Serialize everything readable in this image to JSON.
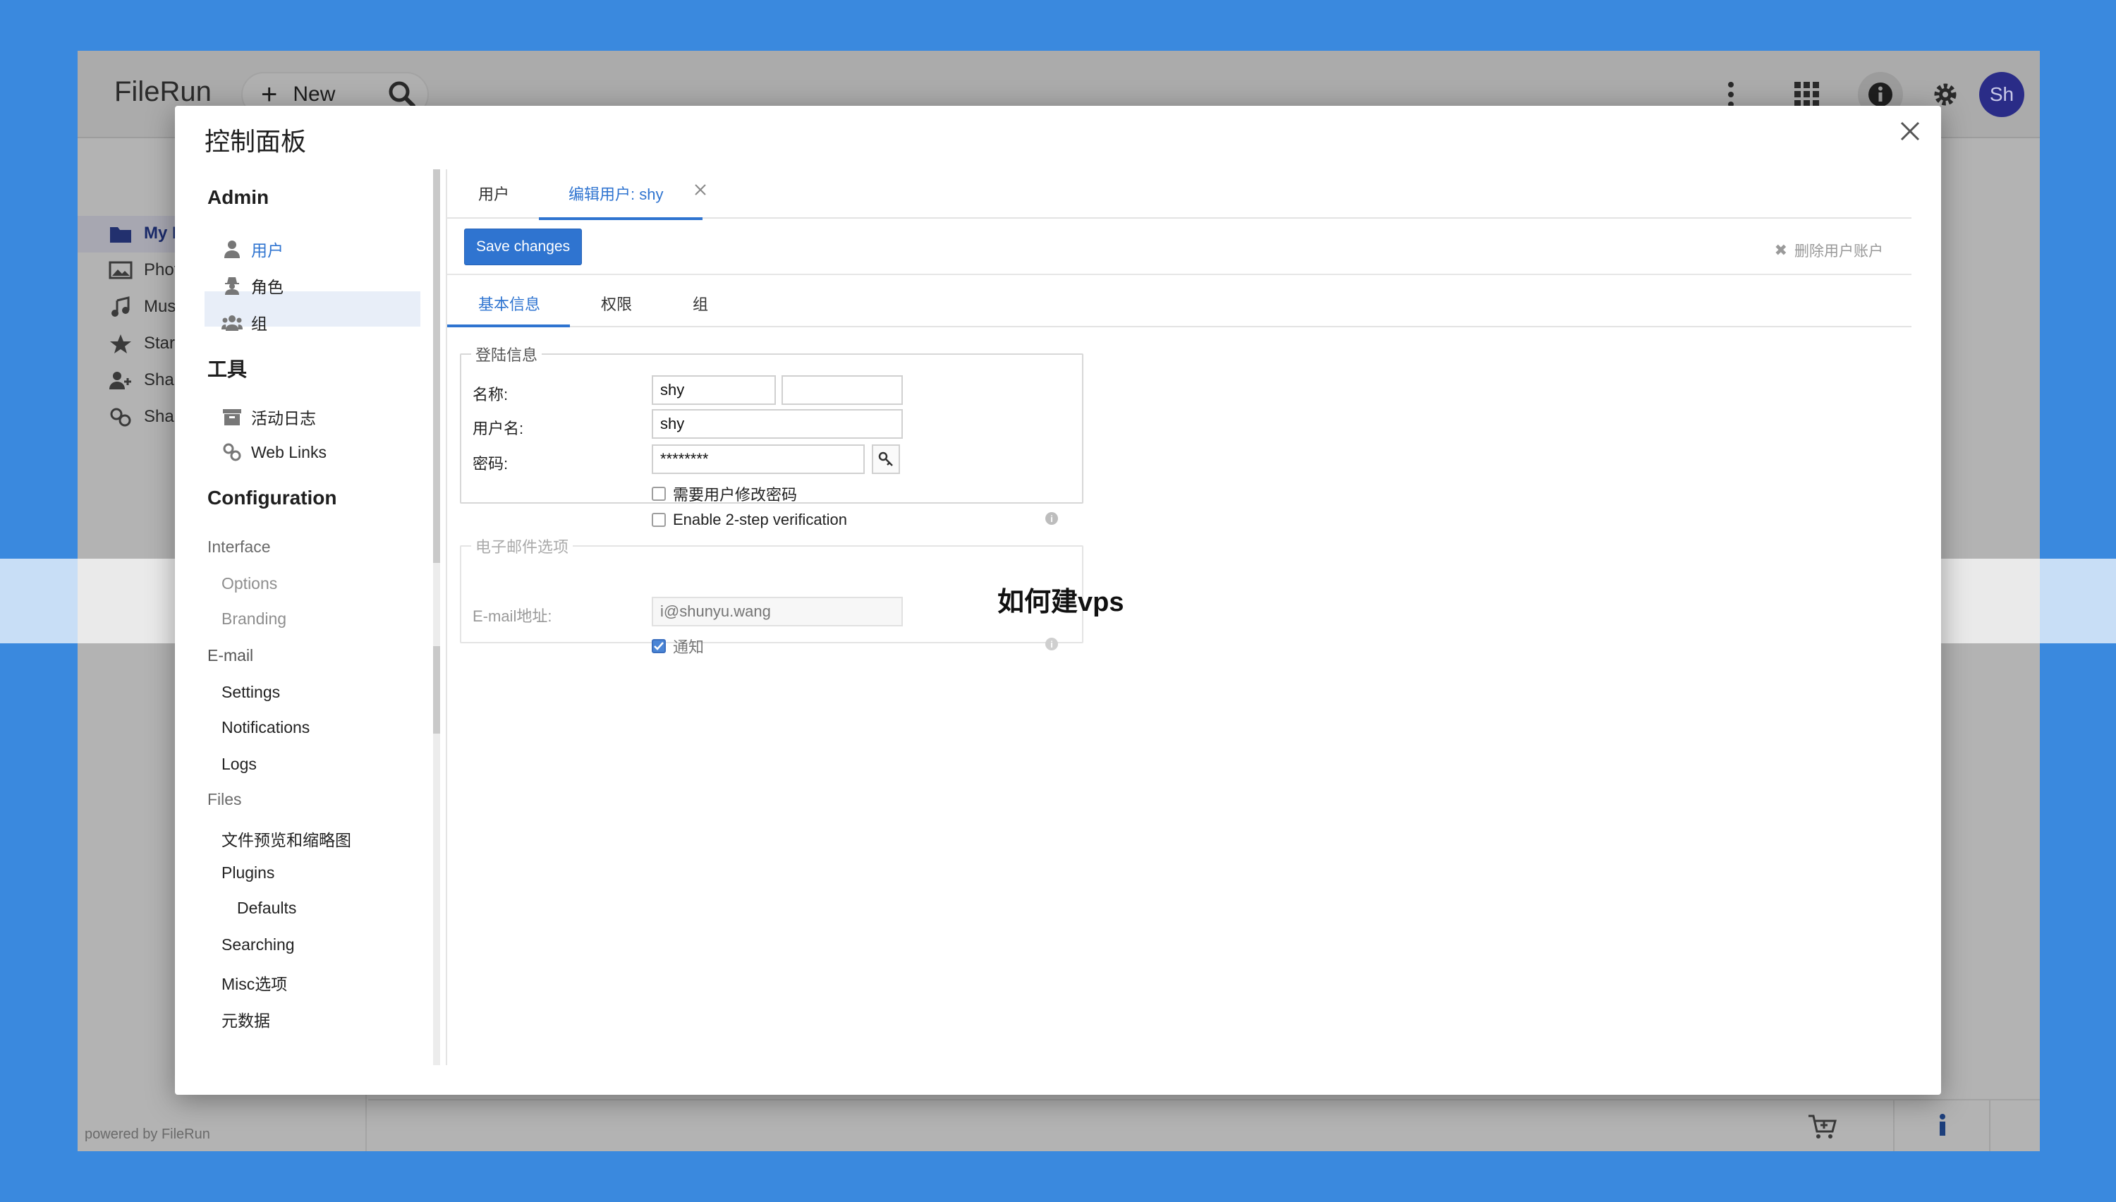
{
  "app": {
    "title": "FileRun",
    "new_button": "New",
    "avatar_initials": "Sh",
    "powered_by": "powered by FileRun",
    "sidenav": [
      "My F",
      "Phot",
      "Mus",
      "Star",
      "Shar",
      "Shar"
    ]
  },
  "modal": {
    "title": "控制面板",
    "nav": {
      "admin_heading": "Admin",
      "admin_items": [
        "用户",
        "角色",
        "组"
      ],
      "tools_heading": "工具",
      "tools_items": [
        "活动日志",
        "Web Links"
      ],
      "config_heading": "Configuration",
      "interface_label": "Interface",
      "interface_items": [
        "Options",
        "Branding"
      ],
      "email_label": "E-mail",
      "email_items": [
        "Settings",
        "Notifications",
        "Logs"
      ],
      "files_label": "Files",
      "files_items": [
        "文件预览和缩略图",
        "Plugins",
        "Defaults",
        "Searching",
        "Misc选项",
        "元数据"
      ]
    },
    "tabs": [
      "用户",
      "编辑用户: shy"
    ],
    "save_button": "Save changes",
    "delete_link": "删除用户账户",
    "inner_tabs": [
      "基本信息",
      "权限",
      "组"
    ],
    "login_section": {
      "legend": "登陆信息",
      "name_label": "名称:",
      "first_name": "shy",
      "last_name": "",
      "username_label": "用户名:",
      "username": "shy",
      "password_label": "密码:",
      "password": "********",
      "require_change_label": "需要用户修改密码",
      "two_step_label": "Enable 2-step verification"
    },
    "email_section": {
      "legend": "电子邮件选项",
      "email_label": "E-mail地址:",
      "email_placeholder": "i@shunyu.wang",
      "notify_label": "通知"
    }
  },
  "watermark": "如何建vps",
  "colors": {
    "background": "#3a89de",
    "accent": "#2f74d0",
    "avatar": "#2a2c87"
  }
}
